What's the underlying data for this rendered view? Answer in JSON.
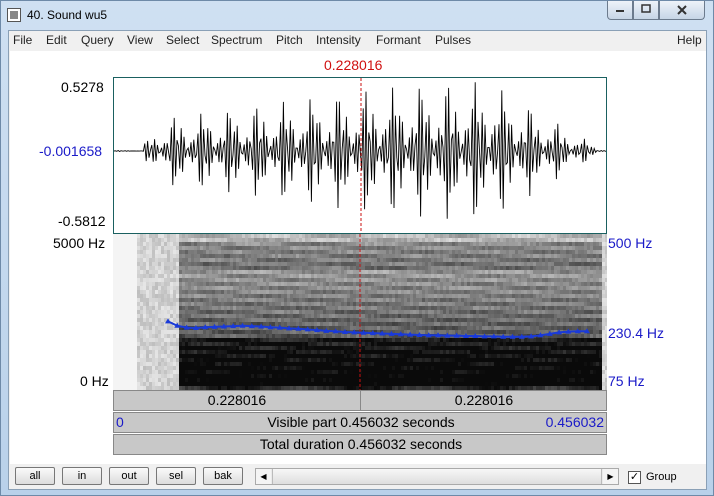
{
  "window": {
    "title": "40. Sound wu5"
  },
  "menu": [
    "File",
    "Edit",
    "Query",
    "View",
    "Select",
    "Spectrum",
    "Pitch",
    "Intensity",
    "Formant",
    "Pulses",
    "Help"
  ],
  "cursor": {
    "time_label": "0.228016"
  },
  "waveform": {
    "max_label": "0.5278",
    "mid_label": "-0.001658",
    "min_label": "-0.5812"
  },
  "spectrogram": {
    "freq_top_label": "5000 Hz",
    "freq_bottom_label": "0 Hz",
    "pitch_top_label": "500 Hz",
    "pitch_cursor_label": "230.4 Hz",
    "pitch_bottom_label": "75 Hz",
    "pitch_color": "#1a3ad8",
    "pitch_contour_hz": [
      262,
      250,
      245,
      244,
      246,
      247,
      248,
      249,
      250,
      249,
      248,
      246,
      245,
      243,
      242,
      240,
      238,
      236,
      235,
      233,
      232,
      231,
      230,
      229,
      228,
      227,
      226,
      225,
      224,
      224,
      223,
      223,
      222,
      222,
      221,
      221,
      220,
      220,
      220,
      221,
      224,
      228,
      232,
      234,
      235,
      235
    ]
  },
  "segments": {
    "left_label": "0.228016",
    "right_label": "0.228016",
    "visible_start": "0",
    "visible_text": "Visible part 0.456032 seconds",
    "visible_end": "0.456032",
    "total_text": "Total duration 0.456032 seconds"
  },
  "controls": {
    "all": "all",
    "in": "in",
    "out": "out",
    "sel": "sel",
    "bak": "bak",
    "group_label": "Group",
    "group_checked": true
  }
}
